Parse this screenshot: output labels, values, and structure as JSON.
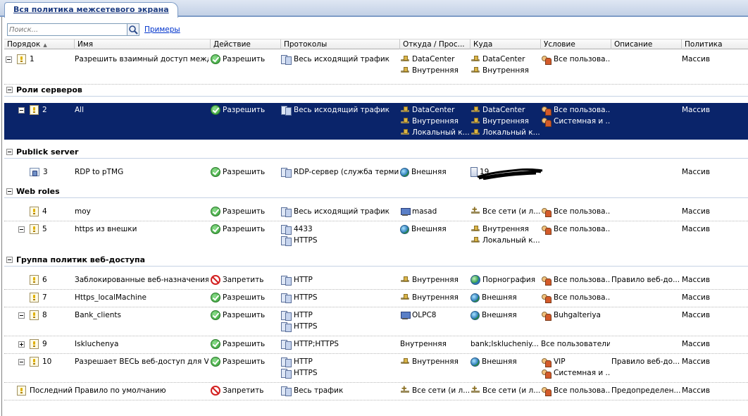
{
  "tab": {
    "title": "Вся политика межсетевого экрана"
  },
  "search": {
    "placeholder": "Поиск...",
    "examples_link": "Примеры"
  },
  "columns": [
    {
      "label": "Порядок",
      "sorted": "ascending"
    },
    {
      "label": "Имя"
    },
    {
      "label": "Действие"
    },
    {
      "label": "Протоколы"
    },
    {
      "label": "Откуда / Прос..."
    },
    {
      "label": "Куда"
    },
    {
      "label": "Условие"
    },
    {
      "label": "Описание"
    },
    {
      "label": "Политика"
    }
  ],
  "groups": [
    {
      "name": "Роли серверов"
    },
    {
      "name": "Publick server"
    },
    {
      "name": "Web roles"
    },
    {
      "name": "Группа политик веб-доступа"
    }
  ],
  "rows": [
    {
      "order": "1",
      "name": "Разрешить взаимный доступ межд...",
      "action": "Разрешить",
      "protocols": [
        "Весь исходящий трафик"
      ],
      "from": [
        "DataCenter",
        "Внутренняя"
      ],
      "to": [
        "DataCenter",
        "Внутренняя"
      ],
      "condition": [
        "Все пользова..."
      ],
      "description": "",
      "policy": "Массив"
    },
    {
      "order": "2",
      "name": "All",
      "action": "Разрешить",
      "protocols": [
        "Весь исходящий трафик"
      ],
      "from": [
        "DataCenter",
        "Внутренняя",
        "Локальный к..."
      ],
      "to": [
        "DataCenter",
        "Внутренняя",
        "Локальный к..."
      ],
      "condition": [
        "Все пользова...",
        "Системная и ..."
      ],
      "description": "",
      "policy": "Массив",
      "selected": true
    },
    {
      "order": "3",
      "name": "RDP to pTMG",
      "action": "Разрешить",
      "protocols": [
        "RDP-сервер (служба терми..."
      ],
      "from": [
        "Внешняя"
      ],
      "to": [
        "19"
      ],
      "condition": [],
      "description": "",
      "policy": "Массив"
    },
    {
      "order": "4",
      "name": "moy",
      "action": "Разрешить",
      "protocols": [
        "Весь исходящий трафик"
      ],
      "from": [
        "masad"
      ],
      "to": [
        "Все сети (и л..."
      ],
      "condition": [
        "Все пользова..."
      ],
      "description": "",
      "policy": "Массив"
    },
    {
      "order": "5",
      "name": "https из внешки",
      "action": "Разрешить",
      "protocols": [
        "4433",
        "HTTPS"
      ],
      "from": [
        "Внешняя"
      ],
      "to": [
        "Внутренняя",
        "Локальный к..."
      ],
      "condition": [
        "Все пользова..."
      ],
      "description": "",
      "policy": "Массив"
    },
    {
      "order": "6",
      "name": "Заблокированные веб-назначения",
      "action": "Запретить",
      "protocols": [
        "HTTP"
      ],
      "from": [
        "Внутренняя"
      ],
      "to": [
        "Порнография"
      ],
      "condition": [
        "Все пользова..."
      ],
      "description": "Правило веб-до...",
      "policy": "Массив"
    },
    {
      "order": "7",
      "name": "Https_localMachine",
      "action": "Разрешить",
      "protocols": [
        "HTTPS"
      ],
      "from": [
        "Внутренняя"
      ],
      "to": [
        "Внешняя"
      ],
      "condition": [
        "Все пользова..."
      ],
      "description": "",
      "policy": "Массив"
    },
    {
      "order": "8",
      "name": "Bank_clients",
      "action": "Разрешить",
      "protocols": [
        "HTTP",
        "HTTPS"
      ],
      "from": [
        "OLPC8"
      ],
      "to": [
        "Внешняя"
      ],
      "condition": [
        "Buhgalteriya"
      ],
      "description": "",
      "policy": "Массив"
    },
    {
      "order": "9",
      "name": "Iskluchenya",
      "action": "Разрешить",
      "protocols": [
        "HTTP;HTTPS"
      ],
      "from": [
        "Внутренняя"
      ],
      "to": [
        "bank;Isklucheniy..."
      ],
      "condition": [
        "Все пользователи"
      ],
      "description": "",
      "policy": "Массив"
    },
    {
      "order": "10",
      "name": "Разрешает ВЕСЬ веб-доступ для V...",
      "action": "Разрешить",
      "protocols": [
        "HTTP",
        "HTTPS"
      ],
      "from": [
        "Внутренняя"
      ],
      "to": [
        "Внешняя"
      ],
      "condition": [
        "VIP",
        "Системная и ..."
      ],
      "description": "Правило веб-до...",
      "policy": "Массив"
    },
    {
      "order": "Последний",
      "name": "Правило по умолчанию",
      "action": "Запретить",
      "protocols": [
        "Весь трафик"
      ],
      "from": [
        "Все сети (и л..."
      ],
      "to": [
        "Все сети (и л..."
      ],
      "condition": [
        "Все пользова..."
      ],
      "description": "Предопределен...",
      "policy": "Массив"
    }
  ]
}
